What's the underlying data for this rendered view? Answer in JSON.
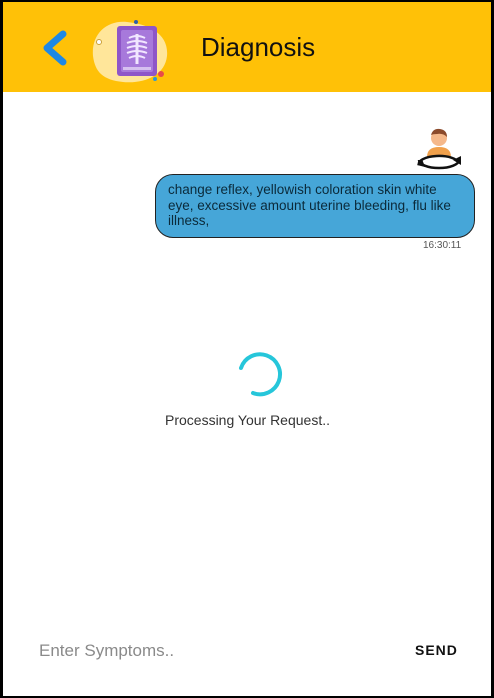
{
  "header": {
    "title": "Diagnosis",
    "back_icon": "chevron-left-icon",
    "logo_icon": "xray-chest-icon",
    "colors": {
      "background": "#FFC107",
      "back_arrow": "#1E88E5"
    }
  },
  "chat": {
    "user_icon": "user-avatar-icon",
    "message": "change reflex, yellowish coloration skin white eye, excessive amount uterine bleeding, flu like illness,",
    "timestamp": "16:30:11",
    "bubble_color": "#46A6D8"
  },
  "loading": {
    "status_text": "Processing Your Request..",
    "spinner_color": "#26C6DA"
  },
  "input": {
    "placeholder": "Enter Symptoms..",
    "value": "",
    "send_label": "SEND"
  }
}
